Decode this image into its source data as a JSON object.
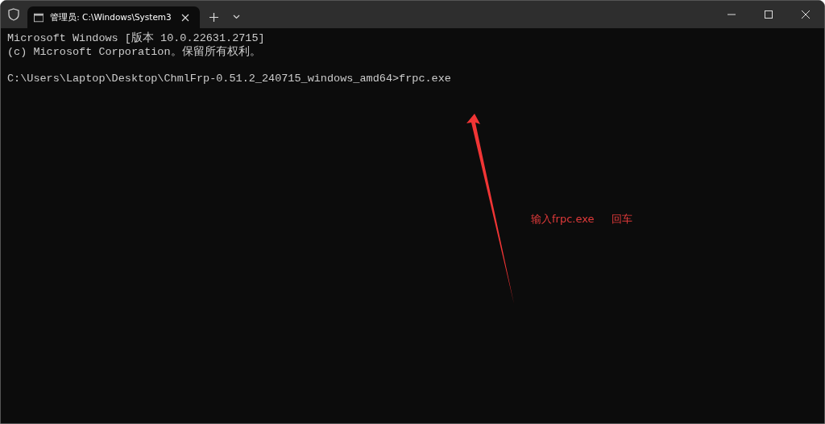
{
  "tab": {
    "title": "管理员: C:\\Windows\\System3",
    "selected": true
  },
  "console_blocks": [
    [
      "Microsoft Windows [版本 10.0.22631.2715]",
      "(c) Microsoft Corporation。保留所有权利。"
    ],
    [
      "C:\\Users\\Laptop\\Desktop\\ChmlFrp-0.51.2_240715_windows_amd64>frpc.exe"
    ]
  ],
  "annotation": {
    "parts": [
      "输入frpc.exe",
      "回车"
    ]
  }
}
